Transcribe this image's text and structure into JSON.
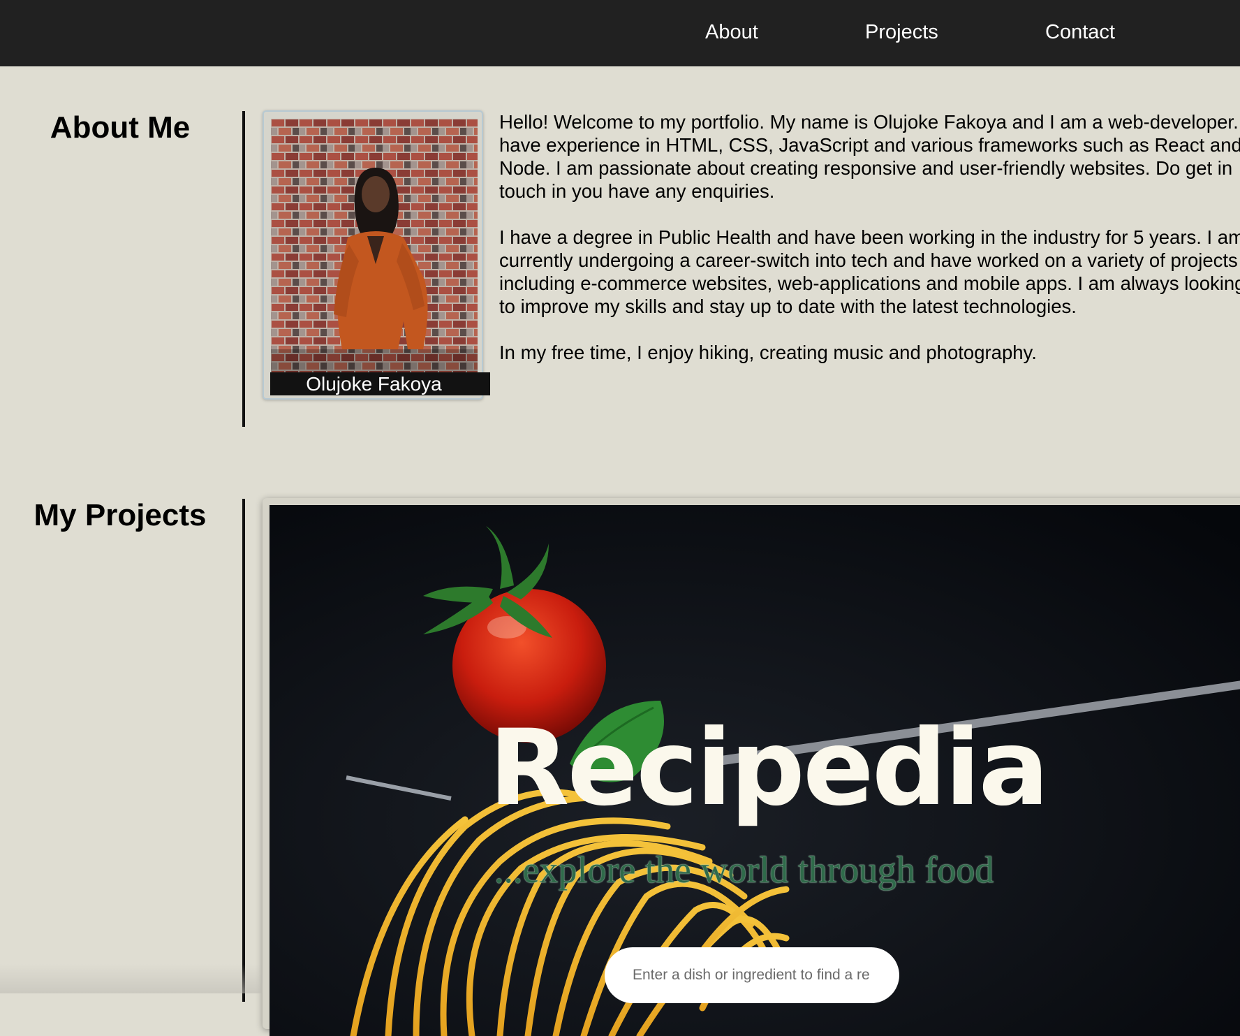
{
  "nav": {
    "links": [
      {
        "label": "About"
      },
      {
        "label": "Projects"
      },
      {
        "label": "Contact"
      }
    ]
  },
  "about": {
    "title": "About Me",
    "photo_caption": "Olujoke Fakoya",
    "paragraphs": [
      "Hello! Welcome to my portfolio. My name is Olujoke Fakoya and I am a web-developer. I have experience in HTML, CSS, JavaScript and various frameworks such as React and Node. I am passionate about creating responsive and user-friendly websites. Do get in touch in you have any enquiries.",
      "I have a degree in Public Health and have been working in the industry for 5 years. I am currently undergoing a career-switch into tech and have worked on a variety of projects including e-commerce websites, web-applications and mobile apps. I am always looking to improve my skills and stay up to date with the latest technologies.",
      "In my free time, I enjoy hiking, creating music and photography."
    ]
  },
  "projects": {
    "title": "My Projects",
    "featured": {
      "name": "Recipedia",
      "tagline": "...explore the world through food",
      "search_placeholder": "Enter a dish or ingredient to find a re"
    }
  },
  "colors": {
    "nav_bg": "#212121",
    "page_bg": "#dfddd2",
    "project_title": "#fbf8ec",
    "tagline": "#2f6a4a"
  }
}
